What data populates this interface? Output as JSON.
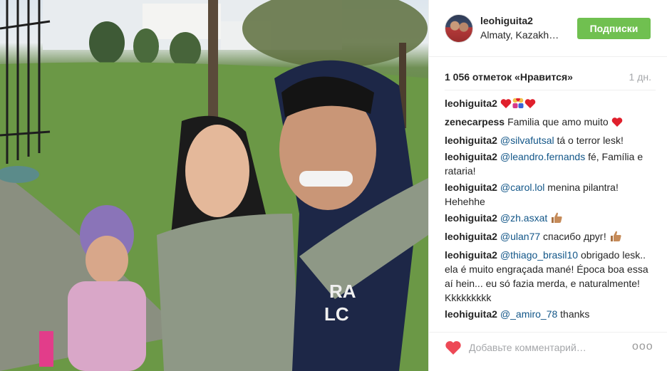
{
  "post": {
    "username": "leohiguita2",
    "location": "Almaty, Kazakh…",
    "follow_label": "Подписки",
    "likes": "1 056 отметок «Нравится»",
    "time": "1 дн.",
    "comment_placeholder": "Добавьте комментарий…",
    "more_label": "ooo"
  },
  "comments": [
    {
      "author": "leohiguita2",
      "text": ""
    },
    {
      "author": "zenecarpess",
      "text": "Familia que amo muito"
    },
    {
      "author": "leohiguita2",
      "mention": "@silvafutsal",
      "text": " tá o terror lesk!"
    },
    {
      "author": "leohiguita2",
      "mention": "@leandro.fernands",
      "text": " fé, Família e rataria!"
    },
    {
      "author": "leohiguita2",
      "mention": "@carol.lol",
      "text": " menina pilantra! Hehehhe"
    },
    {
      "author": "leohiguita2",
      "mention": "@zh.asxat",
      "text": ""
    },
    {
      "author": "leohiguita2",
      "mention": "@ulan77",
      "text": " спасибо друг!"
    },
    {
      "author": "leohiguita2",
      "mention": "@thiago_brasil10",
      "text": " obrigado lesk.. ela é muito engraçada mané! Época boa essa aí hein... eu só fazia merda, e naturalmente! Kkkkkkkkk"
    },
    {
      "author": "leohiguita2",
      "mention": "@_amiro_78",
      "text": " thanks"
    }
  ],
  "colors": {
    "follow_button": "#70c050",
    "mention": "#125688",
    "like_heart": "#ed4956",
    "muted_text": "#a5a7aa"
  },
  "icons": {
    "like": "heart-icon",
    "more": "more-options-icon"
  }
}
